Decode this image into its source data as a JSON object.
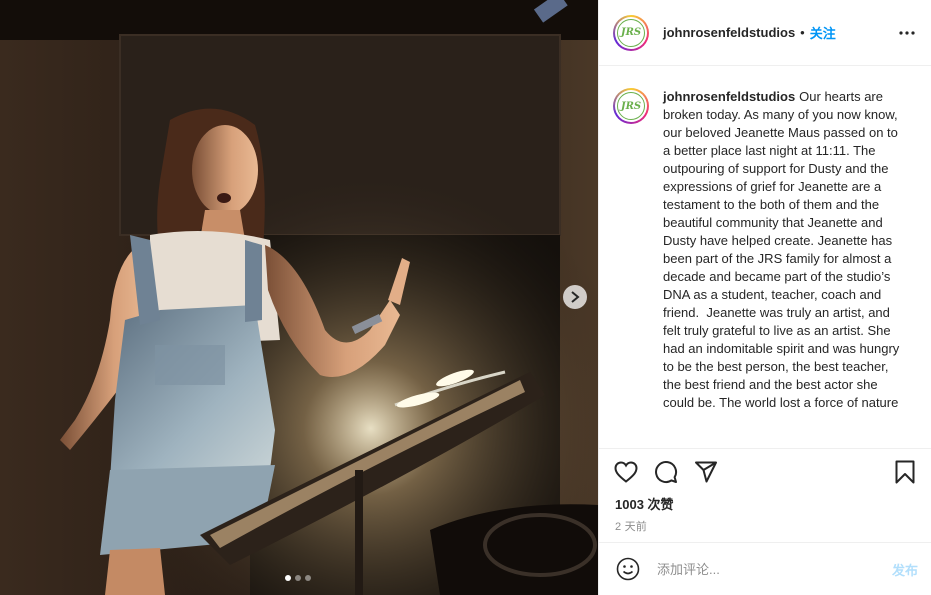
{
  "post": {
    "username": "johnrosenfeldstudios",
    "follow_separator": "•",
    "follow_label": "关注",
    "avatar_text": "JRS",
    "caption": "Our hearts are broken today. As many of you now know, our beloved Jeanette Maus passed on to a better place last night at 11:11. The outpouring of support for Dusty and the expressions of grief for Jeanette are a testament to the both of them and the beautiful community that Jeanette and Dusty have helped create. Jeanette has been part of the JRS family for almost a decade and became part of the studio’s DNA as a student, teacher, coach and friend.  Jeanette was truly an artist, and felt truly grateful to live as an artist. She had an indomitable spirit and was hungry to be the best person, the best teacher, the best friend and the best actor she could be. The world lost a force of nature",
    "likes": "1003 次赞",
    "time": "2 天前",
    "comment_placeholder": "添加评论...",
    "post_label": "发布"
  },
  "carousel": {
    "count": 3,
    "active_index": 0
  },
  "icons": {
    "more": "more-dots-icon",
    "next": "chevron-right-icon",
    "like": "heart-icon",
    "comment": "comment-bubble-icon",
    "share": "paper-plane-icon",
    "save": "bookmark-icon",
    "emoji": "smiley-icon"
  },
  "colors": {
    "link_blue": "#0095f6",
    "post_disabled": "#b2dffc",
    "muted": "#8e8e8e",
    "logo_green": "#6ab04c"
  }
}
